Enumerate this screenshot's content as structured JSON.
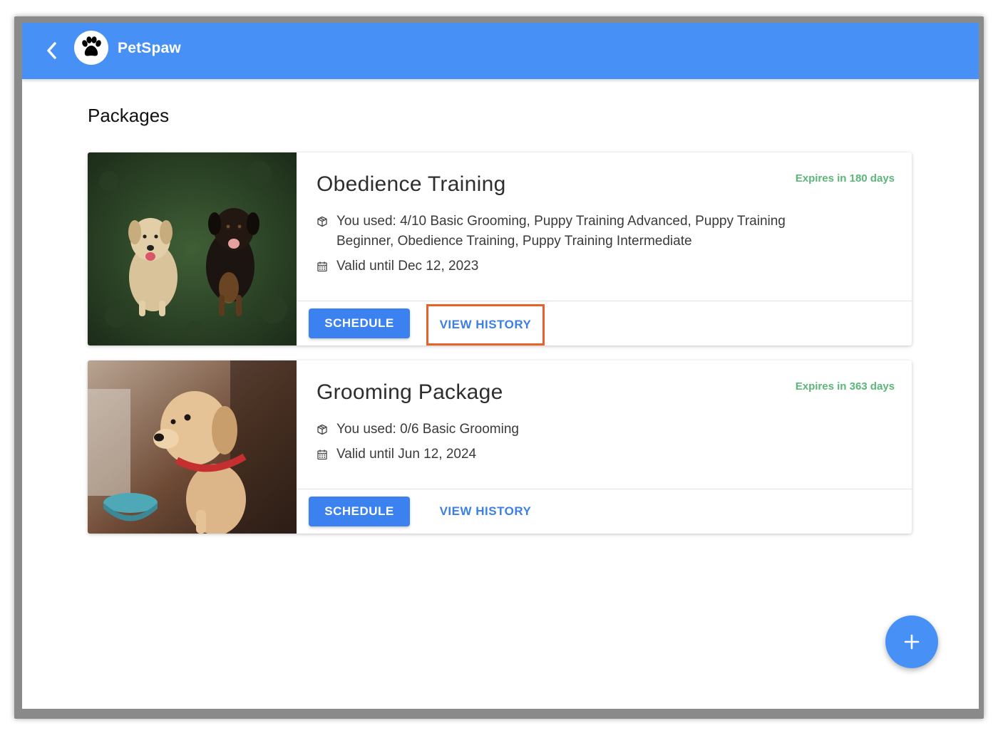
{
  "app": {
    "name": "PetSpaw"
  },
  "page": {
    "title": "Packages"
  },
  "packages": [
    {
      "title": "Obedience Training",
      "expires": "Expires in 180 days",
      "used": "You used: 4/10 Basic Grooming, Puppy Training Advanced, Puppy Training Beginner, Obedience Training, Puppy Training Intermediate",
      "valid": "Valid until Dec 12, 2023",
      "schedule_label": "SCHEDULE",
      "history_label": "VIEW HISTORY",
      "history_highlighted": true,
      "image": "two-dogs-on-grass"
    },
    {
      "title": "Grooming Package",
      "expires": "Expires in 363 days",
      "used": "You used: 0/6 Basic Grooming",
      "valid": "Valid until Jun 12, 2024",
      "schedule_label": "SCHEDULE",
      "history_label": "VIEW HISTORY",
      "history_highlighted": false,
      "image": "puppy-with-red-collar"
    }
  ],
  "icons": {
    "back": "chevron-left-icon",
    "logo": "paw-icon",
    "package": "box-icon",
    "calendar": "calendar-icon",
    "fab": "plus-icon"
  },
  "colors": {
    "appbar": "#4690f6",
    "primary_button": "#3b82f0",
    "link": "#3b7fe8",
    "expires": "#5bb779",
    "highlight": "#e8612c"
  }
}
